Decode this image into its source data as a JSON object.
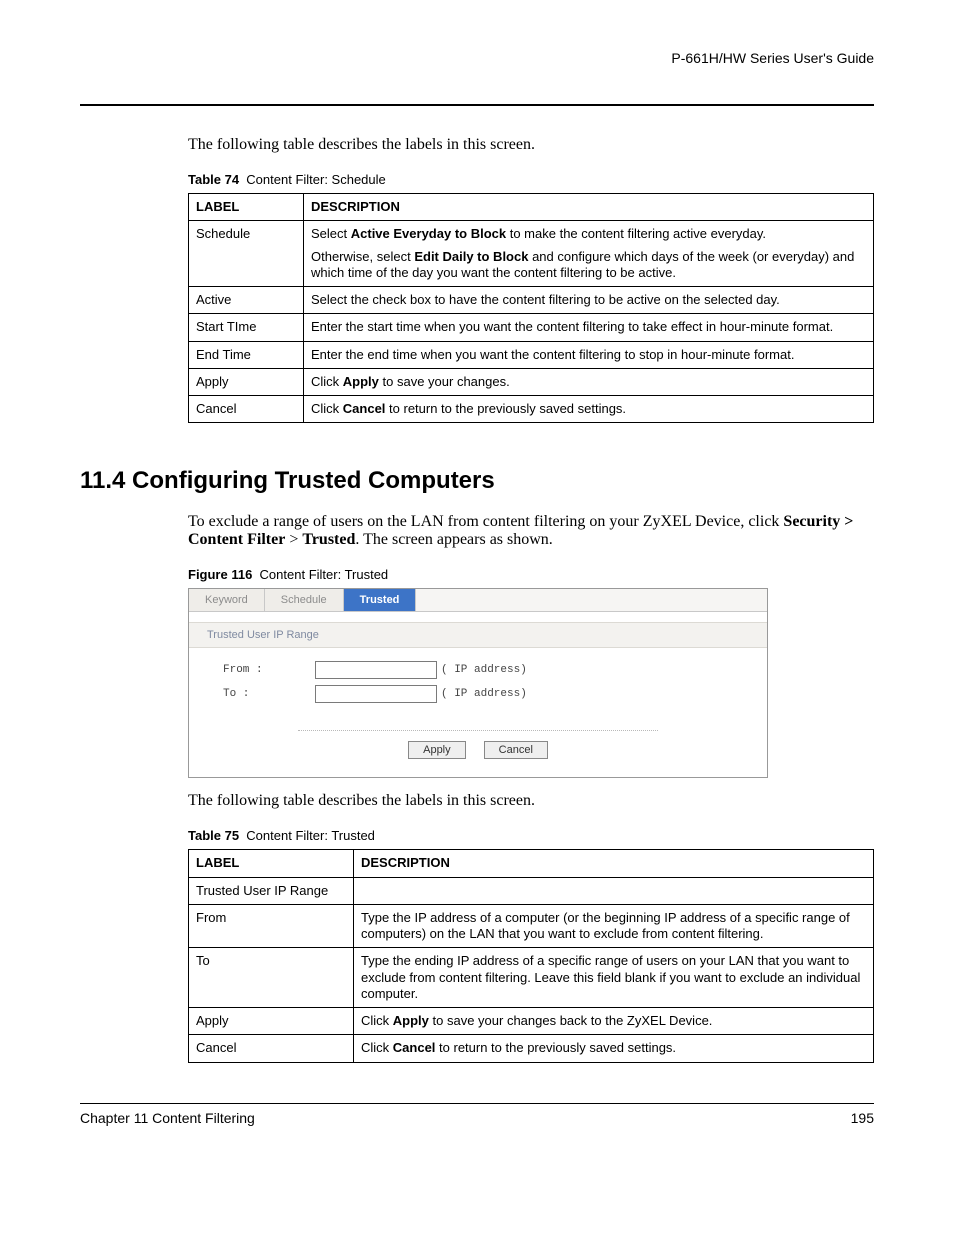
{
  "header": {
    "guide_title": "P-661H/HW Series User's Guide"
  },
  "intro_text_1": "The following table describes the labels in this screen.",
  "table74": {
    "caption_num": "Table 74",
    "caption_title": "Content Filter: Schedule",
    "col_label": "LABEL",
    "col_desc": "DESCRIPTION",
    "rows": {
      "schedule_label": "Schedule",
      "schedule_desc_p1_a": "Select ",
      "schedule_desc_p1_b": "Active Everyday to Block",
      "schedule_desc_p1_c": " to make the content filtering active everyday.",
      "schedule_desc_p2_a": "Otherwise, select ",
      "schedule_desc_p2_b": "Edit Daily to Block",
      "schedule_desc_p2_c": " and configure which days of the week (or everyday) and which time of the day you want the content filtering to be active.",
      "active_label": "Active",
      "active_desc": "Select the check box to have the content filtering to be active on the selected day.",
      "start_label": "Start TIme",
      "start_desc": "Enter the start time when you want the content filtering to take effect in hour-minute format.",
      "end_label": "End Time",
      "end_desc": "Enter the end time when you want the content filtering to stop in hour-minute format.",
      "apply_label": "Apply",
      "apply_desc_a": "Click ",
      "apply_desc_b": "Apply",
      "apply_desc_c": " to save your changes.",
      "cancel_label": "Cancel",
      "cancel_desc_a": "Click ",
      "cancel_desc_b": "Cancel",
      "cancel_desc_c": " to return to the previously saved settings."
    }
  },
  "section": {
    "heading": "11.4  Configuring Trusted Computers",
    "para_a": "To exclude a range of users on the LAN from content filtering on your ZyXEL Device, click ",
    "para_b": "Security > Content Filter",
    "para_c": " > ",
    "para_d": "Trusted",
    "para_e": ". The screen appears as shown."
  },
  "figure": {
    "caption_num": "Figure 116",
    "caption_title": "Content Filter: Trusted",
    "tabs": {
      "keyword": "Keyword",
      "schedule": "Schedule",
      "trusted": "Trusted"
    },
    "section_title": "Trusted User IP Range",
    "from_label": "From :",
    "to_label": "To :",
    "ip_hint": "( IP address)",
    "apply_btn": "Apply",
    "cancel_btn": "Cancel"
  },
  "intro_text_2": "The following table describes the labels in this screen.",
  "table75": {
    "caption_num": "Table 75",
    "caption_title": "Content Filter: Trusted",
    "col_label": "LABEL",
    "col_desc": "DESCRIPTION",
    "rows": {
      "range_label": "Trusted User IP Range",
      "range_desc": "",
      "from_label": "From",
      "from_desc": "Type the IP address of a computer (or the beginning IP address of a specific range of computers) on the LAN that you want to exclude from content filtering.",
      "to_label": "To",
      "to_desc": "Type the ending IP address of a specific range of users on your LAN that you want to exclude from content filtering. Leave this field blank if you want to exclude an individual computer.",
      "apply_label": "Apply",
      "apply_desc_a": "Click ",
      "apply_desc_b": "Apply",
      "apply_desc_c": " to save your changes back to the ZyXEL Device.",
      "cancel_label": "Cancel",
      "cancel_desc_a": "Click ",
      "cancel_desc_b": "Cancel",
      "cancel_desc_c": " to return to the previously saved settings."
    }
  },
  "footer": {
    "chapter": "Chapter 11 Content Filtering",
    "page": "195"
  }
}
